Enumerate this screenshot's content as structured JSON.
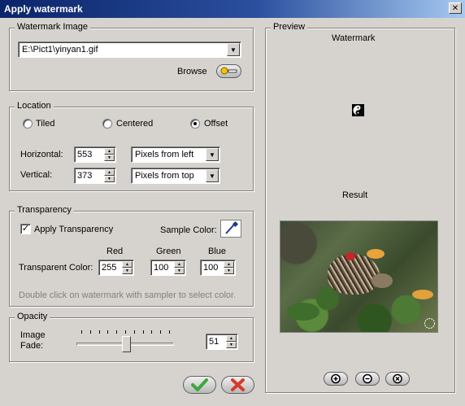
{
  "window": {
    "title": "Apply watermark",
    "close_glyph": "✕"
  },
  "watermark_image": {
    "legend": "Watermark Image",
    "path": "E:\\Pict1\\yinyan1.gif",
    "browse_label": "Browse",
    "browse_icon": "browse-folder-icon"
  },
  "location": {
    "legend": "Location",
    "options": [
      {
        "label": "Tiled",
        "selected": false
      },
      {
        "label": "Centered",
        "selected": false
      },
      {
        "label": "Offset",
        "selected": true
      }
    ],
    "horizontal": {
      "label": "Horizontal:",
      "value": "553",
      "mode": "Pixels from left"
    },
    "vertical": {
      "label": "Vertical:",
      "value": "373",
      "mode": "Pixels from top"
    }
  },
  "transparency": {
    "legend": "Transparency",
    "apply_label": "Apply Transparency",
    "apply_checked": true,
    "sample_color_label": "Sample Color:",
    "sampler_icon": "eyedropper-icon",
    "red_label": "Red",
    "green_label": "Green",
    "blue_label": "Blue",
    "transparent_color_label": "Transparent Color:",
    "red": "255",
    "green": "100",
    "blue": "100",
    "hint": "Double click on watermark with sampler to select color."
  },
  "opacity": {
    "legend": "Opacity",
    "fade_label_line1": "Image",
    "fade_label_line2": "Fade:",
    "value": "51",
    "slider_level": 0.51
  },
  "preview": {
    "legend": "Preview",
    "watermark_label": "Watermark",
    "result_label": "Result",
    "zoom_buttons": [
      "zoom-in-icon",
      "zoom-out-icon",
      "zoom-reset-icon"
    ]
  },
  "actions": {
    "ok_icon": "checkmark-icon",
    "cancel_icon": "x-cancel-icon"
  },
  "colors": {
    "ok": "#3aa83a",
    "cancel": "#d83a2a",
    "title_bar": "#0a246a"
  }
}
